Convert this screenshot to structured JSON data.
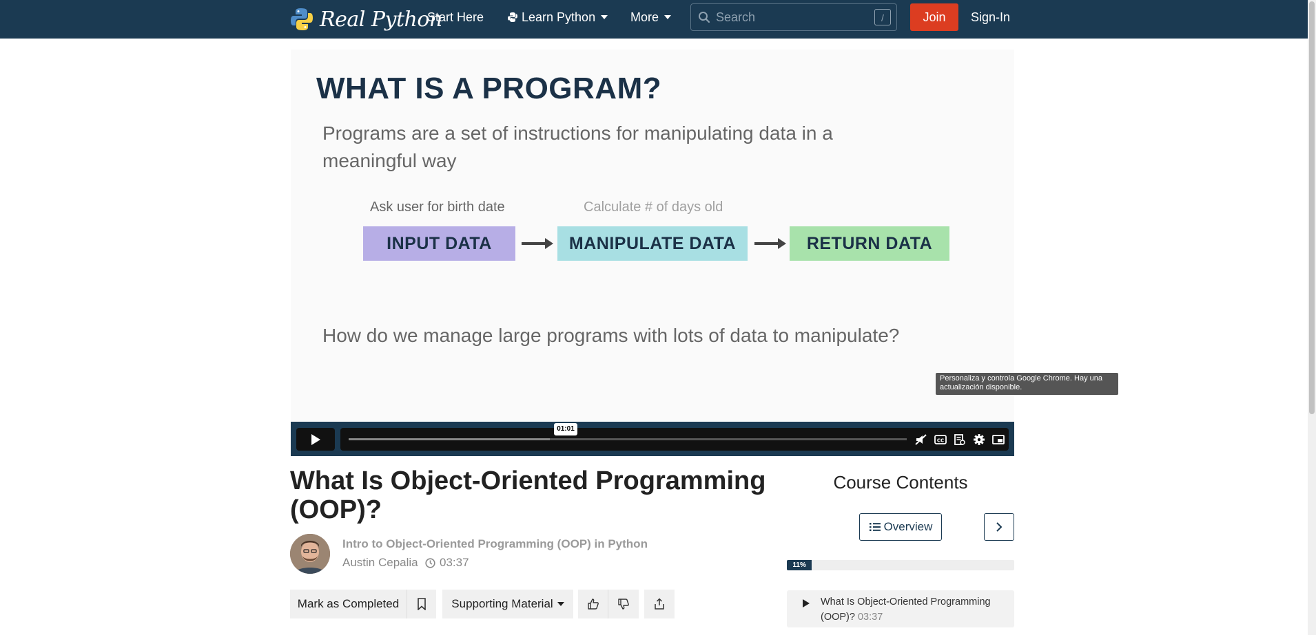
{
  "nav": {
    "logo_text": "Real Python",
    "start_here": "Start Here",
    "learn_python": "Learn Python",
    "more": "More",
    "search_placeholder": "Search",
    "search_shortcut": "/",
    "join": "Join",
    "sign_in": "Sign-In"
  },
  "slide": {
    "title": "WHAT IS A PROGRAM?",
    "intro": "Programs are a set of instructions for manipulating data in a meaningful way",
    "flow": [
      {
        "label": "Ask user for birth date",
        "box": "INPUT DATA",
        "color": "#b7aee6"
      },
      {
        "label": "Calculate # of days old",
        "box": "MANIPULATE DATA",
        "color": "#a8dfe3"
      },
      {
        "label": "",
        "box": "RETURN DATA",
        "color": "#a8e2ab"
      }
    ],
    "question": "How do we manage large programs with lots of data to manipulate?"
  },
  "tooltip": "Personaliza y controla Google Chrome. Hay una actualización disponible.",
  "player": {
    "hover_time": "01:01",
    "progress_fraction": 0.36
  },
  "lesson": {
    "title": "What Is Object-Oriented Programming (OOP)?",
    "course": "Intro to Object-Oriented Programming (OOP) in Python",
    "author": "Austin Cepalia",
    "duration": "03:37",
    "mark_completed": "Mark as Completed",
    "supporting_material": "Supporting Material"
  },
  "sidebar": {
    "title": "Course Contents",
    "overview": "Overview",
    "progress_label": "11%",
    "progress_value": 11,
    "items": [
      {
        "title": "What Is Object-Oriented Programming (OOP)?",
        "time": "03:37"
      }
    ]
  },
  "colors": {
    "navbar": "#1b3a52",
    "join": "#dc3d21",
    "slide_title": "#1b3147"
  }
}
